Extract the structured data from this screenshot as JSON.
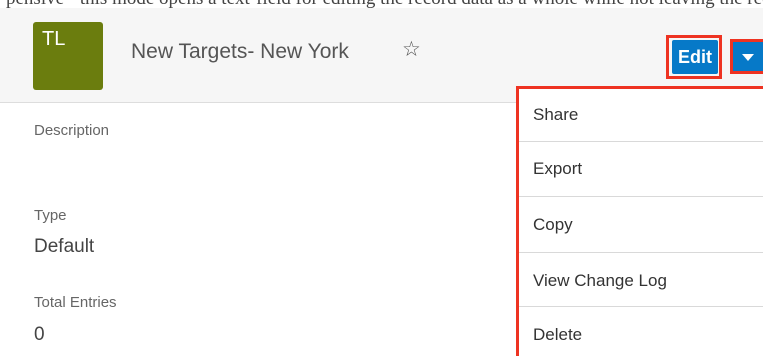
{
  "header": {
    "avatar_initials": "TL",
    "title": "New Targets- New York",
    "edit_label": "Edit"
  },
  "fields": [
    {
      "label": "Description",
      "value": ""
    },
    {
      "label": "Type",
      "value": "Default"
    },
    {
      "label": "Total Entries",
      "value": "0"
    }
  ],
  "menu": {
    "items": [
      "Share",
      "Export",
      "Copy",
      "View Change Log",
      "Delete"
    ]
  },
  "colors": {
    "avatar": "#6b7d0e",
    "primary_button": "#0679c8",
    "highlight": "#ee3322"
  },
  "icons": {
    "favorite": "star-outline-icon",
    "dropdown": "caret-down-icon"
  }
}
